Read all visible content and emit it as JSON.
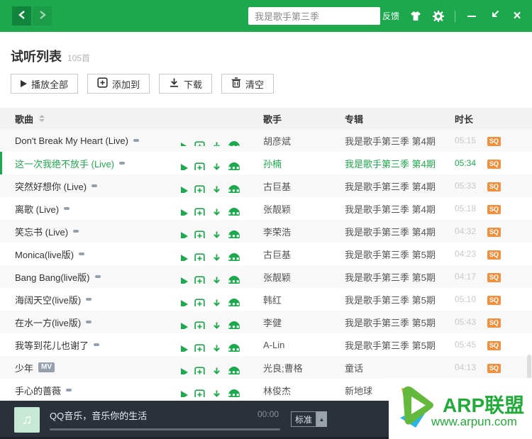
{
  "colors": {
    "brand_green": "#1ea84e",
    "selected_green": "#1daa4c",
    "sq_orange": "#f2913d",
    "player_bg": "#2a313b",
    "watermark_green": "#21ab38"
  },
  "titlebar": {
    "search_value": "我是歌手第三季",
    "feedback_label": "反馈"
  },
  "page": {
    "title": "试听列表",
    "count": "105首"
  },
  "toolbar": {
    "buttons": [
      {
        "label": "播放全部"
      },
      {
        "label": "添加到"
      },
      {
        "label": "下载"
      },
      {
        "label": "清空"
      }
    ]
  },
  "table": {
    "headers": {
      "song": "歌曲",
      "artist": "歌手",
      "album": "专辑",
      "duration": "时长"
    },
    "mv_label": "MV",
    "rows": [
      {
        "song": "Don't Break My Heart (Live)",
        "artist": "胡彦斌",
        "album": "我是歌手第三季 第4期",
        "duration": "05:15",
        "quality": "SQ",
        "selected": false,
        "mv": false
      },
      {
        "song": "这一次我绝不放手 (Live)",
        "artist": "孙楠",
        "album": "我是歌手第三季 第4期",
        "duration": "05:34",
        "quality": "SQ",
        "selected": true,
        "mv": false
      },
      {
        "song": "突然好想你 (Live)",
        "artist": "古巨基",
        "album": "我是歌手第三季 第4期",
        "duration": "05:33",
        "quality": "SQ",
        "selected": false,
        "mv": false
      },
      {
        "song": "离歌 (Live)",
        "artist": "张靓颖",
        "album": "我是歌手第三季 第4期",
        "duration": "05:18",
        "quality": "SQ",
        "selected": false,
        "mv": false
      },
      {
        "song": "笑忘书 (Live)",
        "artist": "李荣浩",
        "album": "我是歌手第三季 第4期",
        "duration": "04:32",
        "quality": "SQ",
        "selected": false,
        "mv": false
      },
      {
        "song": "Monica(live版)",
        "artist": "古巨基",
        "album": "我是歌手第三季 第5期",
        "duration": "04:23",
        "quality": "SQ",
        "selected": false,
        "mv": false
      },
      {
        "song": "Bang Bang(live版)",
        "artist": "张靓颖",
        "album": "我是歌手第三季 第5期",
        "duration": "04:17",
        "quality": "SQ",
        "selected": false,
        "mv": false
      },
      {
        "song": "海阔天空(live版)",
        "artist": "韩红",
        "album": "我是歌手第三季 第5期",
        "duration": "05:10",
        "quality": "SQ",
        "selected": false,
        "mv": false
      },
      {
        "song": "在水一方(live版)",
        "artist": "李健",
        "album": "我是歌手第三季 第5期",
        "duration": "05:43",
        "quality": "SQ",
        "selected": false,
        "mv": false
      },
      {
        "song": "我等到花儿也谢了",
        "artist": "A-Lin",
        "album": "我是歌手第三季 第5期",
        "duration": "05:45",
        "quality": "SQ",
        "selected": false,
        "mv": false
      },
      {
        "song": "少年",
        "artist": "光良;曹格",
        "album": "童话",
        "duration": "04:13",
        "quality": "SQ",
        "selected": false,
        "mv": true
      },
      {
        "song": "手心的蔷薇",
        "artist": "林俊杰",
        "album": "新地球",
        "duration": "",
        "quality": "",
        "selected": false,
        "mv": false
      }
    ]
  },
  "player": {
    "now_playing": "QQ音乐，音乐你的生活",
    "elapsed": "00:00",
    "quality_label": "标准"
  },
  "watermark": {
    "title": "ARP联盟",
    "url": "www.arpun.com"
  }
}
